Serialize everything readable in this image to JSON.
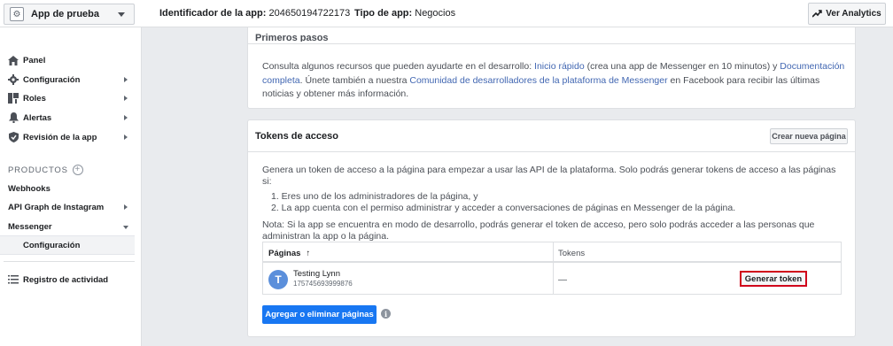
{
  "topbar": {
    "app_name": "App de prueba",
    "app_id_label": "Identificador de la app:",
    "app_id_value": "204650194722173",
    "app_type_label": "Tipo de app:",
    "app_type_value": "Negocios",
    "analytics_label": "Ver Analytics"
  },
  "sidebar": {
    "items": [
      {
        "label": "Panel",
        "icon": "home-icon"
      },
      {
        "label": "Configuración",
        "icon": "gear-icon"
      },
      {
        "label": "Roles",
        "icon": "roles-icon"
      },
      {
        "label": "Alertas",
        "icon": "bell-icon"
      },
      {
        "label": "Revisión de la app",
        "icon": "shield-check-icon"
      }
    ],
    "products_heading": "PRODUCTOS",
    "products": [
      {
        "label": "Webhooks"
      },
      {
        "label": "API Graph de Instagram"
      },
      {
        "label": "Messenger"
      },
      {
        "label": "Configuración"
      }
    ],
    "activity_log": "Registro de actividad"
  },
  "getting_started": {
    "title": "Primeros pasos",
    "text_1": "Consulta algunos recursos que pueden ayudarte en el desarrollo: ",
    "link_quick_start": "Inicio rápido",
    "text_2": " (crea una app de Messenger en 10 minutos) y ",
    "link_docs": "Documentación completa",
    "text_3": ". Únete también a nuestra ",
    "link_community": "Comunidad de desarrolladores de la plataforma de Messenger",
    "text_4": " en Facebook para recibir las últimas noticias y obtener más información."
  },
  "access_tokens": {
    "title": "Tokens de acceso",
    "create_page_label": "Crear nueva página",
    "intro": "Genera un token de acceso a la página para empezar a usar las API de la plataforma. Solo podrás generar tokens de acceso a las páginas si:",
    "conditions": [
      "1. Eres uno de los administradores de la página, y",
      "2. La app cuenta con el permiso administrar y acceder a conversaciones de páginas en Messenger de la página."
    ],
    "note": "Nota: Si la app se encuentra en modo de desarrollo, podrás generar el token de acceso, pero solo podrás acceder a las personas que administran la app o la página.",
    "table": {
      "col_pages": "Páginas",
      "sort_icon": "↑",
      "col_tokens": "Tokens",
      "rows": [
        {
          "avatar_letter": "T",
          "name": "Testing Lynn",
          "id": "175745693999876",
          "token": "—",
          "action": "Generar token"
        }
      ]
    },
    "add_remove_label": "Agregar o eliminar páginas",
    "info_icon": "i"
  },
  "colors": {
    "primary": "#1877f2",
    "link": "#4267b2",
    "highlight": "#d0021b"
  }
}
